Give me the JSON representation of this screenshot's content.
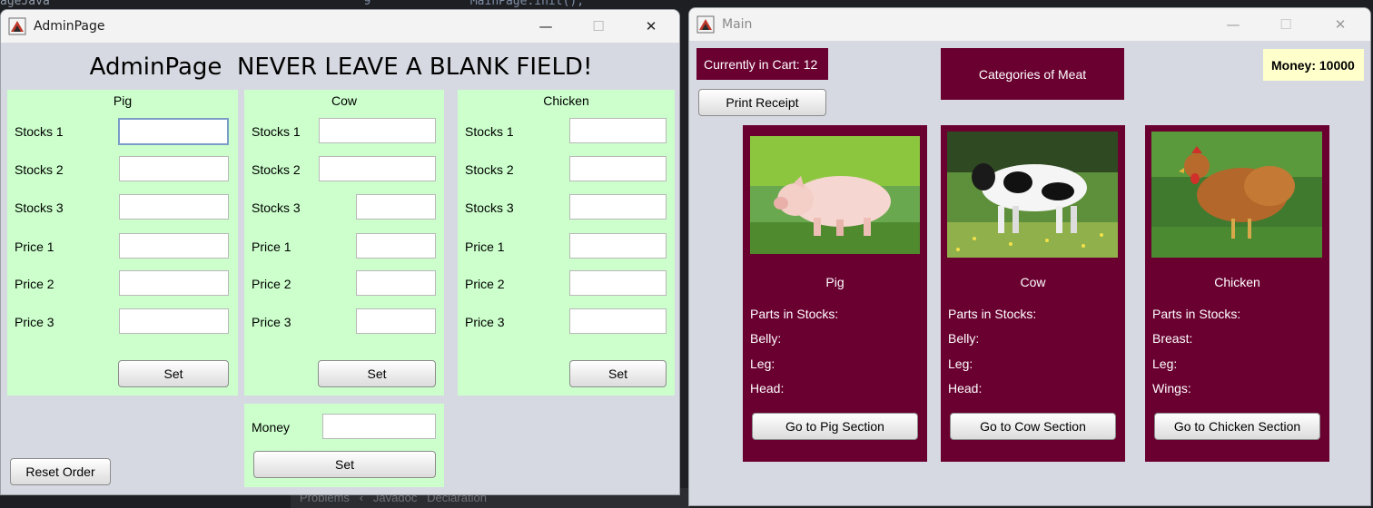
{
  "background": {
    "code_line": "         9              MainPage.init();",
    "side_fragment": "ageJava",
    "bottom_strip": "Problems   ‹   Javadoc   Declaration"
  },
  "admin": {
    "title": "AdminPage",
    "heading": "AdminPage  NEVER LEAVE A BLANK FIELD!",
    "controls": {
      "minimize": "—",
      "maximize": "☐",
      "close": "✕"
    },
    "panels": [
      {
        "title": "Pig",
        "labels": [
          "Stocks 1",
          "Stocks 2",
          "Stocks 3",
          "Price 1",
          "Price 2",
          "Price 3"
        ],
        "values": [
          "",
          "",
          "",
          "",
          "",
          ""
        ],
        "set_label": "Set"
      },
      {
        "title": "Cow",
        "labels": [
          "Stocks 1",
          "Stocks 2",
          "Stocks 3",
          "Price 1",
          "Price 2",
          "Price 3"
        ],
        "values": [
          "",
          "",
          "",
          "",
          "",
          ""
        ],
        "set_label": "Set"
      },
      {
        "title": "Chicken",
        "labels": [
          "Stocks 1",
          "Stocks 2",
          "Stocks 3",
          "Price 1",
          "Price 2",
          "Price 3"
        ],
        "values": [
          "",
          "",
          "",
          "",
          "",
          ""
        ],
        "set_label": "Set"
      }
    ],
    "money": {
      "label": "Money",
      "value": "",
      "set_label": "Set"
    },
    "reset_label": "Reset Order"
  },
  "main": {
    "title": "Main",
    "controls": {
      "minimize": "—",
      "maximize": "☐",
      "close": "✕"
    },
    "cart_text": "Currently in Cart: 12",
    "print_receipt": "Print Receipt",
    "categories_title": "Categories of Meat",
    "money_text": "Money: 10000",
    "cards": [
      {
        "name": "Pig",
        "parts_heading": "Parts in Stocks:",
        "parts": [
          "Belly:",
          "Leg:",
          "Head:"
        ],
        "button": "Go to Pig Section",
        "photo": "pig-photo"
      },
      {
        "name": "Cow",
        "parts_heading": "Parts in Stocks:",
        "parts": [
          "Belly:",
          "Leg:",
          "Head:"
        ],
        "button": "Go to Cow Section",
        "photo": "cow-photo"
      },
      {
        "name": "Chicken",
        "parts_heading": "Parts in Stocks:",
        "parts": [
          "Breast:",
          "Leg:",
          "Wings:"
        ],
        "button": "Go to Chicken Section",
        "photo": "chicken-photo"
      }
    ]
  },
  "colors": {
    "panel_green": "#ccffcc",
    "maroon": "#6a0030",
    "money_yellow": "#ffffcc",
    "window_bg": "#d6d9e1"
  }
}
